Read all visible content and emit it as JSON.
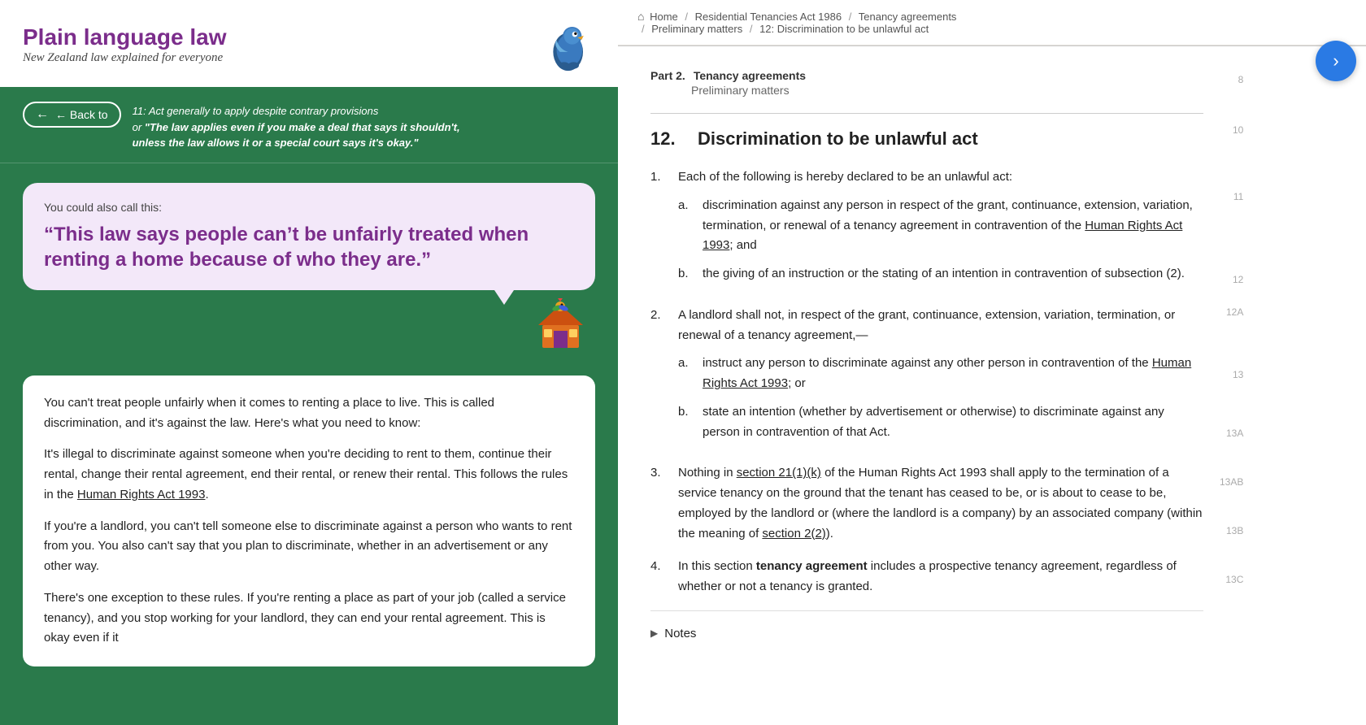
{
  "left": {
    "header": {
      "title": "Plain language law",
      "subtitle": "New Zealand law explained for everyone"
    },
    "back_button": "← Back to",
    "back_nav_line1": "11: Act generally to apply despite contrary provisions",
    "back_nav_line2": "or \"The law applies even if you make a deal that says it shouldn't,",
    "back_nav_line3": "unless the law allows it or a special court says it's okay.\"",
    "bubble_label": "You could also call this:",
    "bubble_quote": "“This law says people can’t be unfairly treated when renting a home because of who they are.”",
    "explanation": [
      "You can’t treat people unfairly when it comes to renting a place to live. This is called discrimination, and it’s against the law. Here’s what you need to know:",
      "It’s illegal to discriminate against someone when you’re deciding to rent to them, continue their rental, change their rental agreement, end their rental, or renew their rental. This follows the rules in the Human Rights Act 1993.",
      "If you’re a landlord, you can’t tell someone else to discriminate against a person who wants to rent from you. You also can’t say that you plan to discriminate, whether in an advertisement or any other way.",
      "There’s one exception to these rules. If you’re renting a place as part of your job (called a service tenancy), and you stop working for your landlord, they can end your rental agreement. This is okay even if it"
    ],
    "human_rights_link": "Human Rights Act 1993"
  },
  "right": {
    "breadcrumb": {
      "home": "Home",
      "part1": "Residential Tenancies Act 1986",
      "part2": "Tenancy agreements",
      "part3": "Preliminary matters",
      "part4": "12: Discrimination to be unlawful act"
    },
    "part_number": "Part 2.",
    "part_title": "Tenancy agreements",
    "part_sub": "Preliminary matters",
    "section_number": "12.",
    "section_title": "Discrimination to be unlawful act",
    "items": [
      {
        "num": "1.",
        "text": "Each of the following is hereby declared to be an unlawful act:",
        "sub": [
          {
            "letter": "a.",
            "text": "discrimination against any person in respect of the grant, continuance, extension, variation, termination, or renewal of a tenancy agreement in contravention of the Human Rights Act 1993; and"
          },
          {
            "letter": "b.",
            "text": "the giving of an instruction or the stating of an intention in contravention of subsection (2)."
          }
        ]
      },
      {
        "num": "2.",
        "text": "A landlord shall not, in respect of the grant, continuance, extension, variation, termination, or renewal of a tenancy agreement,—",
        "sub": [
          {
            "letter": "a.",
            "text": "instruct any person to discriminate against any other person in contravention of the Human Rights Act 1993; or"
          },
          {
            "letter": "b.",
            "text": "state an intention (whether by advertisement or otherwise) to discriminate against any person in contravention of that Act."
          }
        ]
      },
      {
        "num": "3.",
        "text": "Nothing in section 21(1)(k) of the Human Rights Act 1993 shall apply to the termination of a service tenancy on the ground that the tenant has ceased to be, or is about to cease to be, employed by the landlord or (where the landlord is a company) by an associated company (within the meaning of section 2(2)).",
        "sub": []
      },
      {
        "num": "4.",
        "text": "In this section tenancy agreement includes a prospective tenancy agreement, regardless of whether or not a tenancy is granted.",
        "sub": []
      }
    ],
    "notes_label": "Notes",
    "line_numbers": [
      "8",
      "10",
      "11",
      "12",
      "12A",
      "13",
      "13A",
      "13AB",
      "13B",
      "13C"
    ]
  },
  "fab": {
    "icon": "❯",
    "label": "expand"
  }
}
